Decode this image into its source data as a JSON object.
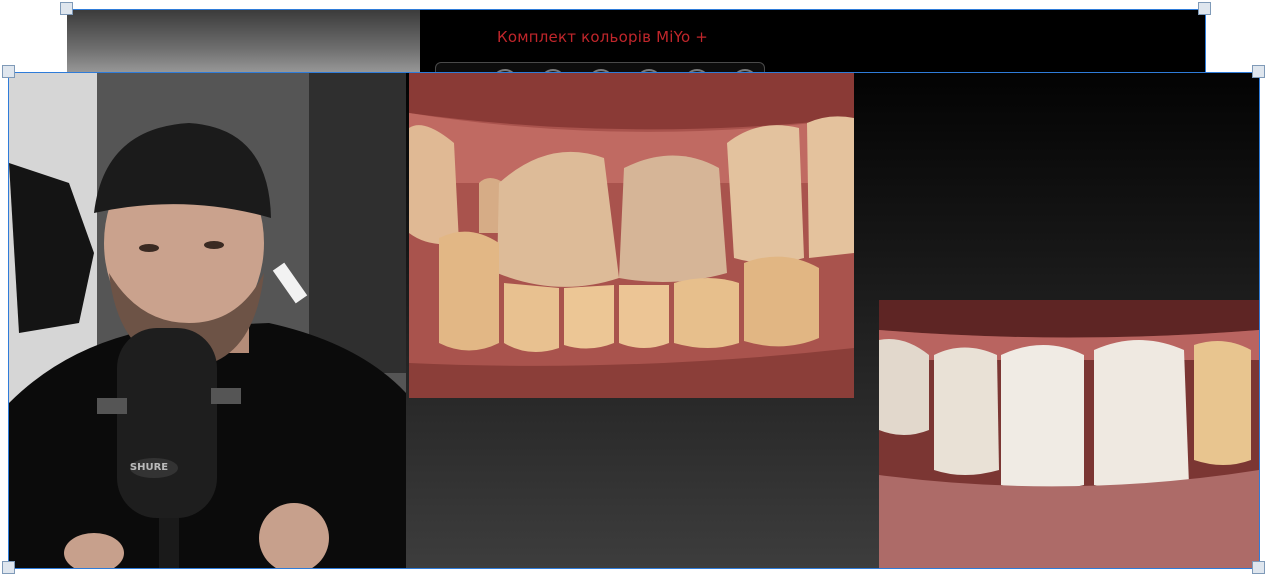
{
  "back_slide": {
    "title": "Комплект кольорів MiYo +",
    "swatch_count": 6
  },
  "front_slide": {
    "webcam": {
      "microphone_brand": "SHURE"
    },
    "photos": [
      "teeth-before-photo",
      "teeth-after-photo"
    ]
  },
  "colors": {
    "selection_blue": "#2f7cd9",
    "title_red": "#c0262b"
  }
}
